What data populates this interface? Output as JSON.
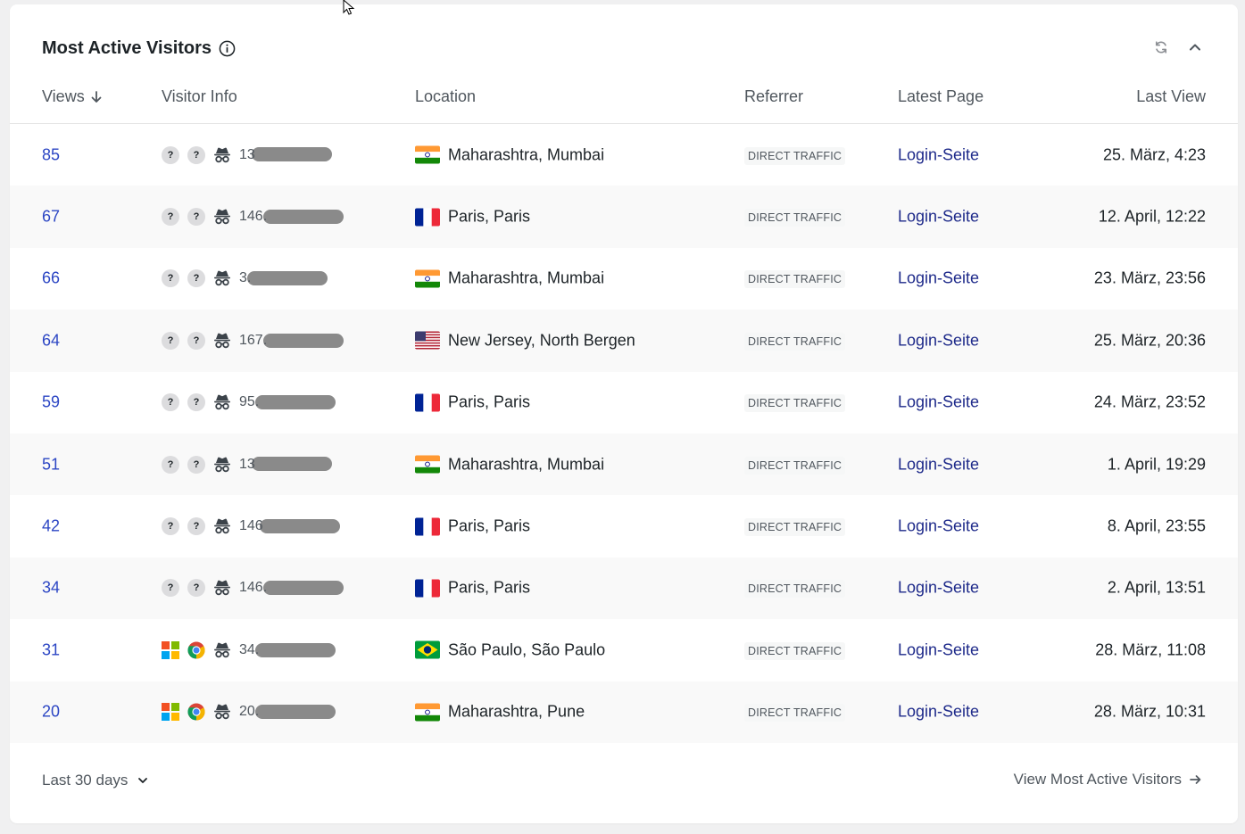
{
  "widget": {
    "title": "Most Active Visitors",
    "colors": {
      "link": "#2c46c4",
      "page_link": "#1e2a8a",
      "muted": "#50575e"
    }
  },
  "columns": {
    "views": "Views",
    "visitor_info": "Visitor Info",
    "location": "Location",
    "referrer": "Referrer",
    "latest_page": "Latest Page",
    "last_view": "Last View"
  },
  "rows": [
    {
      "views": "85",
      "os_icon": "question-icon",
      "browser_icon": "question-icon",
      "ip": "13",
      "flag": "in",
      "location": "Maharashtra, Mumbai",
      "referrer": "DIRECT TRAFFIC",
      "latest_page": "Login-Seite",
      "last_view": "25. März, 4:23"
    },
    {
      "views": "67",
      "os_icon": "question-icon",
      "browser_icon": "question-icon",
      "ip": "146.",
      "flag": "fr",
      "location": "Paris, Paris",
      "referrer": "DIRECT TRAFFIC",
      "latest_page": "Login-Seite",
      "last_view": "12. April, 12:22"
    },
    {
      "views": "66",
      "os_icon": "question-icon",
      "browser_icon": "question-icon",
      "ip": "3.",
      "flag": "in",
      "location": "Maharashtra, Mumbai",
      "referrer": "DIRECT TRAFFIC",
      "latest_page": "Login-Seite",
      "last_view": "23. März, 23:56"
    },
    {
      "views": "64",
      "os_icon": "question-icon",
      "browser_icon": "question-icon",
      "ip": "167.",
      "flag": "us",
      "location": "New Jersey, North Bergen",
      "referrer": "DIRECT TRAFFIC",
      "latest_page": "Login-Seite",
      "last_view": "25. März, 20:36"
    },
    {
      "views": "59",
      "os_icon": "question-icon",
      "browser_icon": "question-icon",
      "ip": "95.",
      "flag": "fr",
      "location": "Paris, Paris",
      "referrer": "DIRECT TRAFFIC",
      "latest_page": "Login-Seite",
      "last_view": "24. März, 23:52"
    },
    {
      "views": "51",
      "os_icon": "question-icon",
      "browser_icon": "question-icon",
      "ip": "13",
      "flag": "in",
      "location": "Maharashtra, Mumbai",
      "referrer": "DIRECT TRAFFIC",
      "latest_page": "Login-Seite",
      "last_view": "1. April, 19:29"
    },
    {
      "views": "42",
      "os_icon": "question-icon",
      "browser_icon": "question-icon",
      "ip": "146",
      "flag": "fr",
      "location": "Paris, Paris",
      "referrer": "DIRECT TRAFFIC",
      "latest_page": "Login-Seite",
      "last_view": "8. April, 23:55"
    },
    {
      "views": "34",
      "os_icon": "question-icon",
      "browser_icon": "question-icon",
      "ip": "146.",
      "flag": "fr",
      "location": "Paris, Paris",
      "referrer": "DIRECT TRAFFIC",
      "latest_page": "Login-Seite",
      "last_view": "2. April, 13:51"
    },
    {
      "views": "31",
      "os_icon": "windows-icon",
      "browser_icon": "chrome-icon",
      "ip": "34.",
      "flag": "br",
      "location": "São Paulo, São Paulo",
      "referrer": "DIRECT TRAFFIC",
      "latest_page": "Login-Seite",
      "last_view": "28. März, 11:08"
    },
    {
      "views": "20",
      "os_icon": "windows-icon",
      "browser_icon": "chrome-icon",
      "ip": "20.",
      "flag": "in",
      "location": "Maharashtra, Pune",
      "referrer": "DIRECT TRAFFIC",
      "latest_page": "Login-Seite",
      "last_view": "28. März, 10:31"
    }
  ],
  "footer": {
    "period": "Last 30 days",
    "view_all": "View Most Active Visitors"
  }
}
